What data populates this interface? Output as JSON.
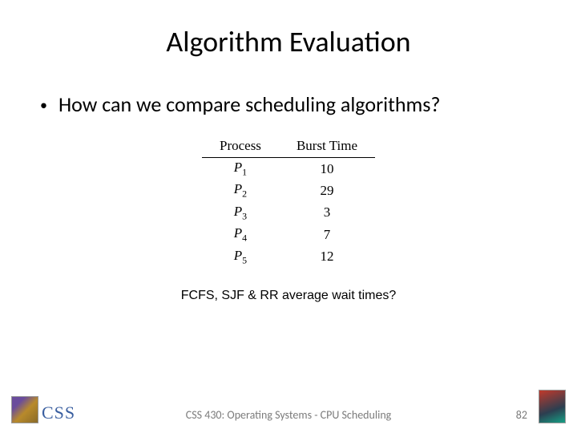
{
  "title": "Algorithm Evaluation",
  "bullet": {
    "marker": "•",
    "text": "How can we compare scheduling algorithms?"
  },
  "table": {
    "headers": {
      "process": "Process",
      "burst": "Burst Time"
    },
    "rows": [
      {
        "name": "P",
        "sub": "1",
        "burst": "10"
      },
      {
        "name": "P",
        "sub": "2",
        "burst": "29"
      },
      {
        "name": "P",
        "sub": "3",
        "burst": "3"
      },
      {
        "name": "P",
        "sub": "4",
        "burst": "7"
      },
      {
        "name": "P",
        "sub": "5",
        "burst": "12"
      }
    ]
  },
  "caption": "FCFS, SJF & RR average wait times?",
  "footer": {
    "logo_text": "CSS",
    "center": "CSS 430: Operating Systems - CPU Scheduling",
    "page": "82"
  }
}
